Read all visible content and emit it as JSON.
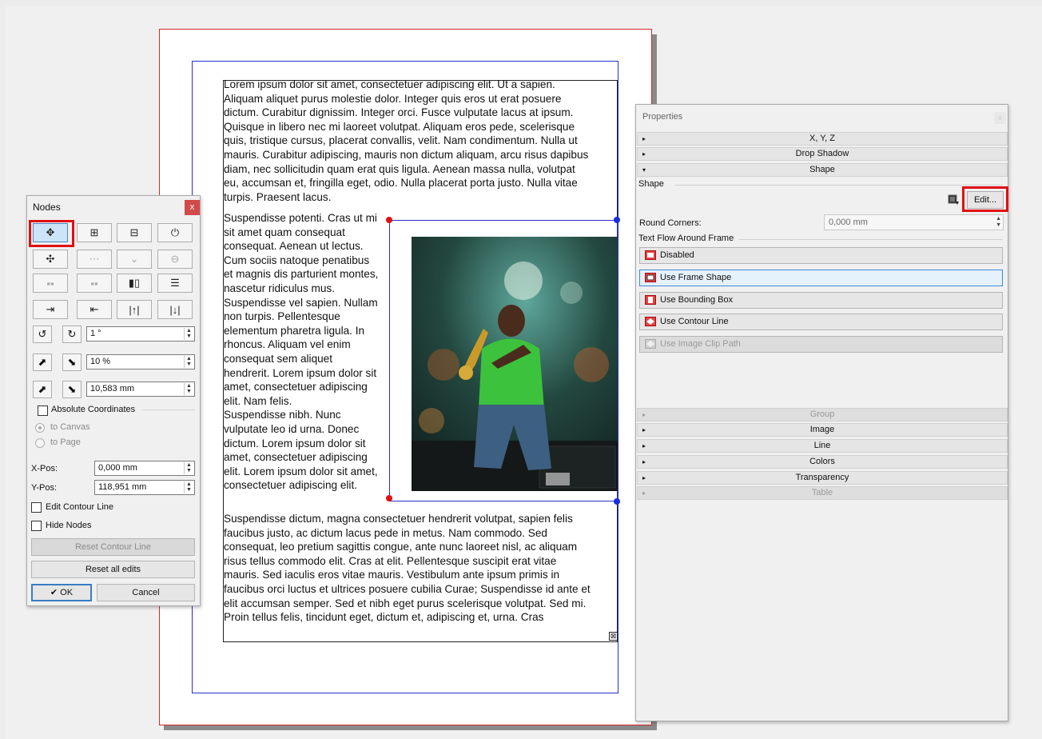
{
  "canvas": {
    "paragraph1": "Lorem ipsum dolor sit amet, consectetuer adipiscing elit. Ut a sapien.\nAliquam aliquet purus molestie dolor. Integer quis eros ut erat posuere\ndictum. Curabitur dignissim. Integer orci. Fusce vulputate lacus at ipsum.\nQuisque in libero nec mi laoreet volutpat. Aliquam eros pede, scelerisque\nquis, tristique cursus, placerat convallis, velit. Nam condimentum. Nulla ut\nmauris. Curabitur adipiscing, mauris non dictum aliquam, arcu risus dapibus\ndiam, nec sollicitudin quam erat quis ligula. Aenean massa nulla, volutpat\neu, accumsan et, fringilla eget, odio. Nulla placerat porta justo. Nulla vitae\nturpis. Praesent lacus.",
    "paragraph2": "Suspendisse potenti. Cras ut mi\nsit amet quam consequat\nconsequat. Aenean ut lectus.\nCum sociis natoque penatibus\net magnis dis parturient montes,\nnascetur ridiculus mus.\nSuspendisse vel sapien. Nullam\nnon turpis. Pellentesque\nelementum pharetra ligula. In\nrhoncus. Aliquam vel enim\nconsequat sem aliquet\nhendrerit. Lorem ipsum dolor sit\namet, consectetuer adipiscing\nelit. Nam felis.\nSuspendisse nibh. Nunc\nvulputate leo id urna. Donec\ndictum. Lorem ipsum dolor sit\namet, consectetuer adipiscing\nelit. Lorem ipsum dolor sit amet,\nconsectetuer adipiscing elit.",
    "paragraph3": "Suspendisse dictum, magna consectetuer hendrerit volutpat, sapien felis\nfaucibus justo, ac dictum lacus pede in metus. Nam commodo. Sed\nconsequat, leo pretium sagittis congue, ante nunc laoreet nisl, ac aliquam\nrisus tellus commodo elit. Cras at elit. Pellentesque suscipit erat vitae\nmauris. Sed iaculis eros vitae mauris. Vestibulum ante ipsum primis in\nfaucibus orci luctus et ultrices posuere cubilia Curae; Suspendisse id ante et\nelit accumsan semper. Sed et nibh eget purus scelerisque volutpat. Sed mi.\nProin tellus felis, tincidunt eget, dictum et, adipiscing et, urna. Cras",
    "overflow_mark": "⊠"
  },
  "nodes": {
    "title": "Nodes",
    "close": "x",
    "rotate_value": "1 °",
    "scale_percent_value": "10 %",
    "scale_mm_value": "10,583 mm",
    "absolute_coordinates": "Absolute Coordinates",
    "to_canvas": "to Canvas",
    "to_page": "to Page",
    "xpos_label": "X-Pos:",
    "xpos_value": "0,000 mm",
    "ypos_label": "Y-Pos:",
    "ypos_value": "118,951 mm",
    "edit_contour": "Edit Contour Line",
    "hide_nodes": "Hide Nodes",
    "reset_contour": "Reset Contour Line",
    "reset_all": "Reset all edits",
    "ok": "✔ OK",
    "cancel": "Cancel"
  },
  "properties": {
    "title": "Properties",
    "close": "x",
    "sections_top": [
      {
        "label": "X, Y, Z",
        "tri": "▸"
      },
      {
        "label": "Drop Shadow",
        "tri": "▸"
      },
      {
        "label": "Shape",
        "tri": "▾"
      }
    ],
    "shape_group": "Shape",
    "edit_button": "Edit...",
    "round_corners_label": "Round Corners:",
    "round_corners_value": "0,000 mm",
    "text_flow_group": "Text Flow Around Frame",
    "flow_options": [
      "Disabled",
      "Use Frame Shape",
      "Use Bounding Box",
      "Use Contour Line",
      "Use Image Clip Path"
    ],
    "sections_bottom": [
      {
        "label": "Group",
        "tri": "▸",
        "disabled": true
      },
      {
        "label": "Image",
        "tri": "▸"
      },
      {
        "label": "Line",
        "tri": "▸"
      },
      {
        "label": "Colors",
        "tri": "▸"
      },
      {
        "label": "Transparency",
        "tri": "▸"
      },
      {
        "label": "Table",
        "tri": "▸",
        "disabled": true
      }
    ]
  },
  "colors": {
    "selection_red": "#e01010",
    "frame_blue": "#1a2ce0",
    "selected_button": "#cce4f7"
  }
}
